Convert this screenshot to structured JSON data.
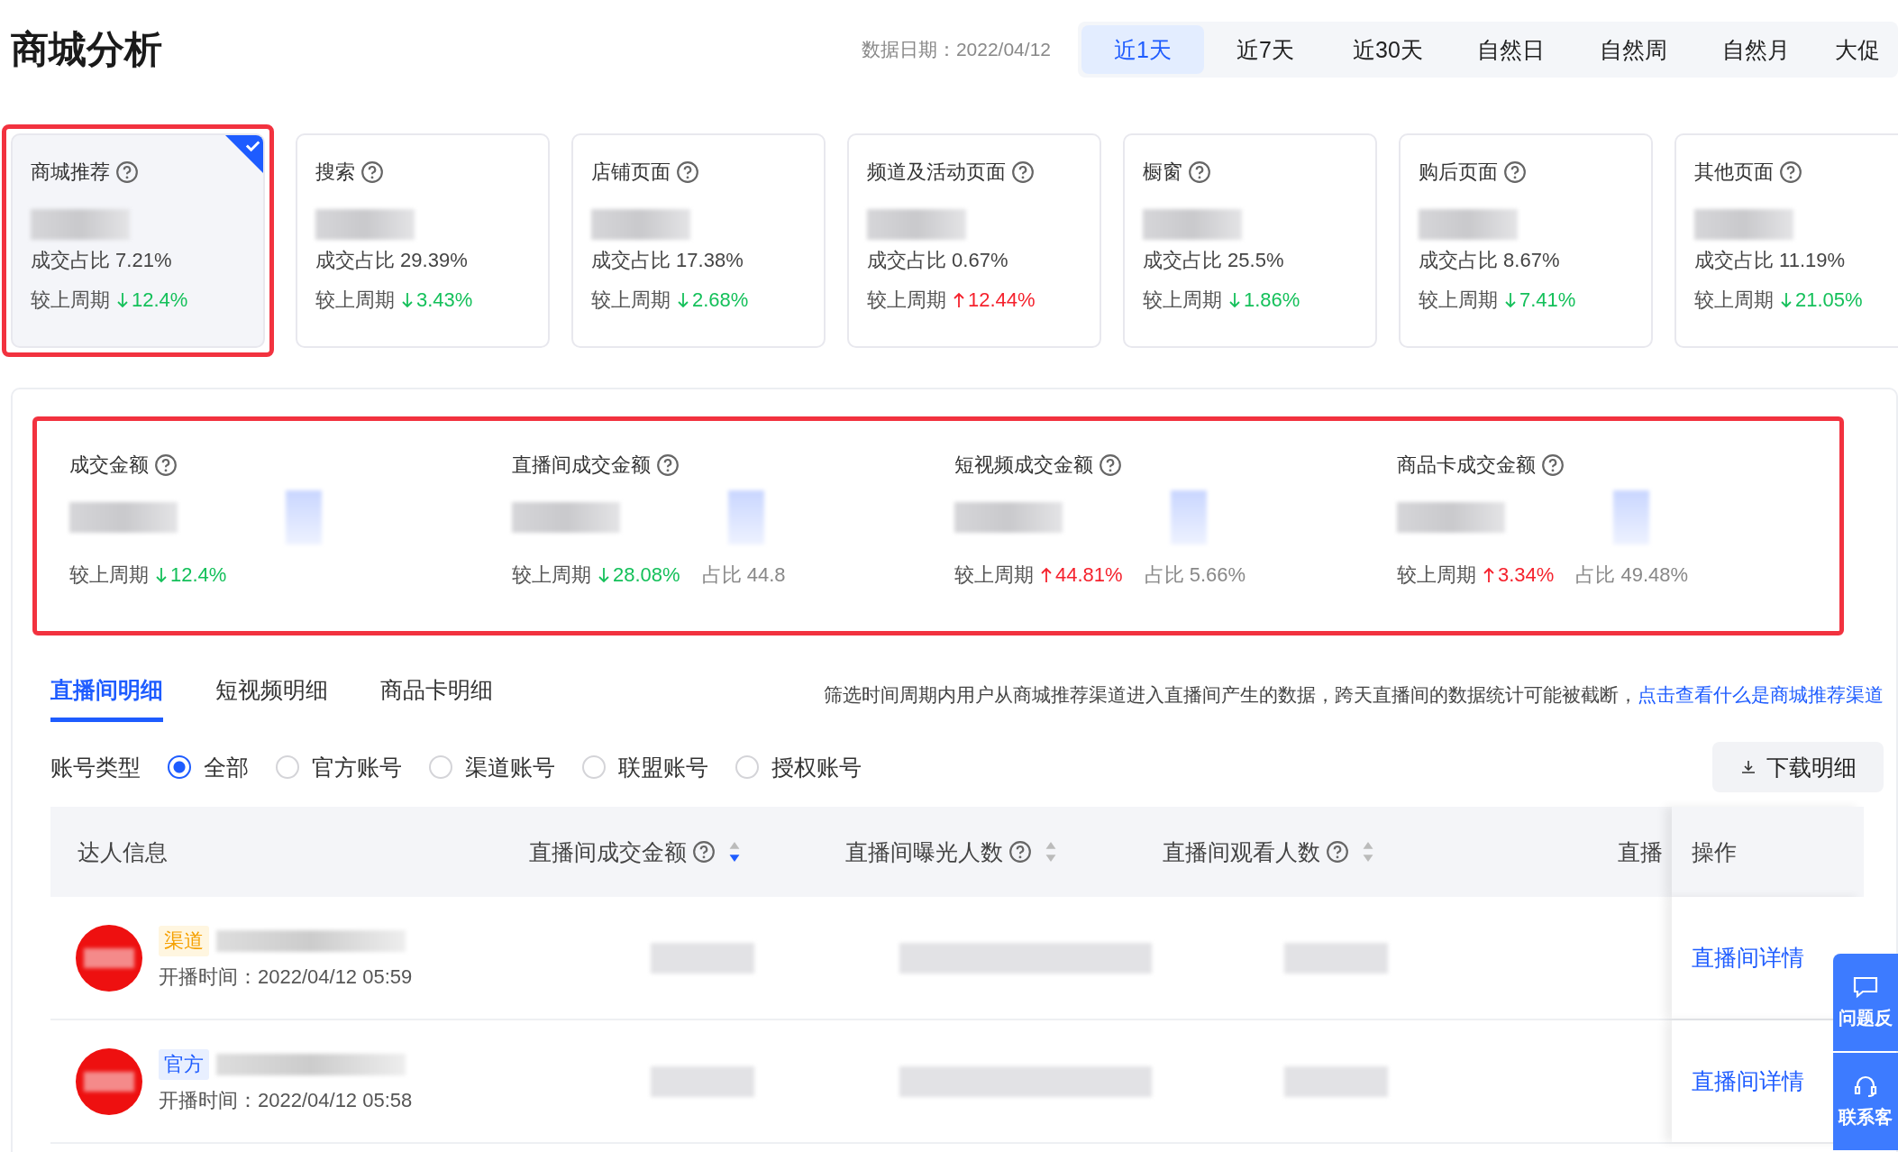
{
  "header": {
    "title": "商城分析",
    "date_label": "数据日期：",
    "date": "2022/04/12"
  },
  "ranges": [
    {
      "label": "近1天",
      "selected": true
    },
    {
      "label": "近7天",
      "selected": false
    },
    {
      "label": "近30天",
      "selected": false
    },
    {
      "label": "自然日",
      "selected": false
    },
    {
      "label": "自然周",
      "selected": false
    },
    {
      "label": "自然月",
      "selected": false
    },
    {
      "label": "大促",
      "selected": false
    }
  ],
  "channel_cards": [
    {
      "label": "商城推荐",
      "share": "成交占比 7.21%",
      "compare_label": "较上周期",
      "change": "12.4%",
      "up": false,
      "selected": true,
      "highlighted": true
    },
    {
      "label": "搜索",
      "share": "成交占比 29.39%",
      "compare_label": "较上周期",
      "change": "3.43%",
      "up": false,
      "selected": false,
      "highlighted": false
    },
    {
      "label": "店铺页面",
      "share": "成交占比 17.38%",
      "compare_label": "较上周期",
      "change": "2.68%",
      "up": false,
      "selected": false,
      "highlighted": false
    },
    {
      "label": "频道及活动页面",
      "share": "成交占比 0.67%",
      "compare_label": "较上周期",
      "change": "12.44%",
      "up": true,
      "selected": false,
      "highlighted": false
    },
    {
      "label": "橱窗",
      "share": "成交占比 25.5%",
      "compare_label": "较上周期",
      "change": "1.86%",
      "up": false,
      "selected": false,
      "highlighted": false
    },
    {
      "label": "购后页面",
      "share": "成交占比 8.67%",
      "compare_label": "较上周期",
      "change": "7.41%",
      "up": false,
      "selected": false,
      "highlighted": false
    },
    {
      "label": "其他页面",
      "share": "成交占比 11.19%",
      "compare_label": "较上周期",
      "change": "21.05%",
      "up": false,
      "selected": false,
      "highlighted": false
    }
  ],
  "metrics_panel": {
    "highlighted": true,
    "metrics": [
      {
        "label": "成交金额",
        "compare_label": "较上周期",
        "change": "12.4%",
        "up": false
      },
      {
        "label": "直播间成交金额",
        "compare_label": "较上周期",
        "change": "28.08%",
        "up": false,
        "share": "占比 44.8"
      },
      {
        "label": "短视频成交金额",
        "compare_label": "较上周期",
        "change": "44.81%",
        "up": true,
        "share": "占比 5.66%"
      },
      {
        "label": "商品卡成交金额",
        "compare_label": "较上周期",
        "change": "3.34%",
        "up": true,
        "share": "占比 49.48%"
      }
    ]
  },
  "detail_tabs": [
    {
      "label": "直播间明细",
      "selected": true
    },
    {
      "label": "短视频明细",
      "selected": false
    },
    {
      "label": "商品卡明细",
      "selected": false
    }
  ],
  "notice": {
    "text": "筛选时间周期内用户从商城推荐渠道进入直播间产生的数据，跨天直播间的数据统计可能被截断，",
    "link": "点击查看什么是商城推荐渠道"
  },
  "filter": {
    "label": "账号类型",
    "options": [
      {
        "label": "全部",
        "selected": true
      },
      {
        "label": "官方账号",
        "selected": false
      },
      {
        "label": "渠道账号",
        "selected": false
      },
      {
        "label": "联盟账号",
        "selected": false
      },
      {
        "label": "授权账号",
        "selected": false
      }
    ]
  },
  "download_button": "下载明细",
  "table": {
    "columns": [
      {
        "label": "达人信息",
        "help": false,
        "sortable": false
      },
      {
        "label": "直播间成交金额",
        "help": true,
        "sortable": true,
        "sorted": true
      },
      {
        "label": "直播间曝光人数",
        "help": true,
        "sortable": true,
        "sorted": false
      },
      {
        "label": "直播间观看人数",
        "help": true,
        "sortable": true,
        "sorted": false
      },
      {
        "label": "直播",
        "help": false,
        "sortable": false
      }
    ],
    "action_column": "操作",
    "rows": [
      {
        "tag": "渠道",
        "kind": "channel",
        "start_time": "开播时间：2022/04/12 05:59",
        "action": "直播间详情"
      },
      {
        "tag": "官方",
        "kind": "official",
        "start_time": "开播时间：2022/04/12 05:58",
        "action": "直播间详情"
      }
    ]
  },
  "side_buttons": [
    {
      "label": "问题反",
      "kind": "feedback"
    },
    {
      "label": "联系客",
      "kind": "service"
    }
  ]
}
